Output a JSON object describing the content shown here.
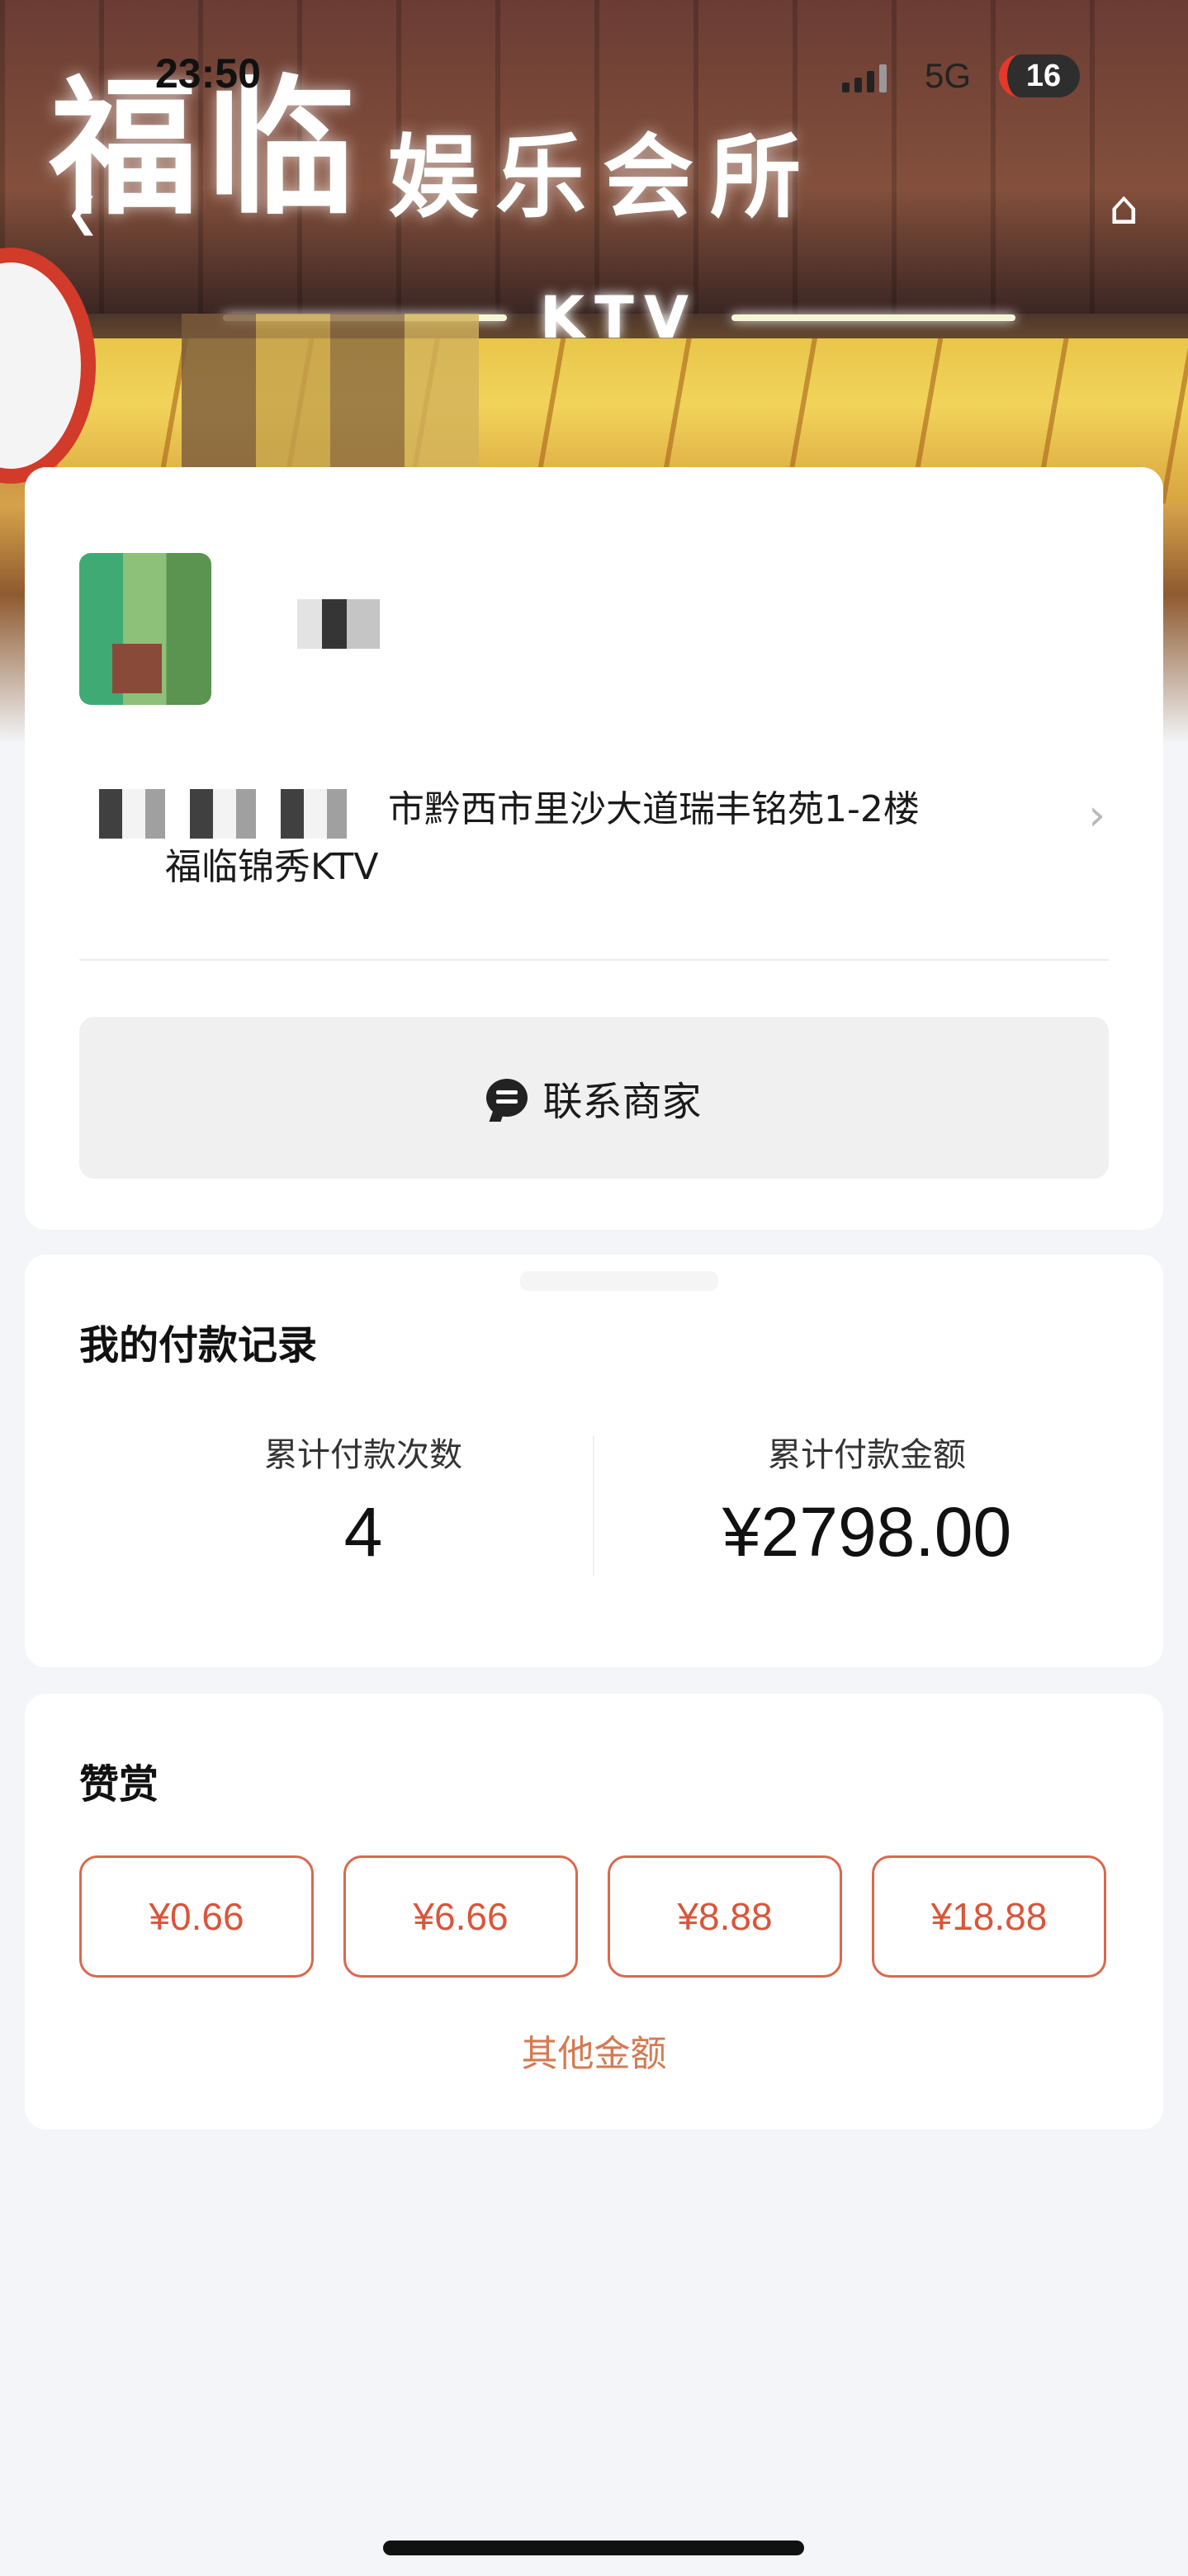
{
  "status_bar": {
    "time": "23:50",
    "network": "5G",
    "battery": "16"
  },
  "hero": {
    "sign_big": "福临",
    "sign_small": "娱乐会所",
    "sign_ktv": "KTV",
    "icons": [
      "back-arrow-icon",
      "home-icon"
    ]
  },
  "merchant": {
    "address_line1": "市黔西市里沙大道瑞丰铭苑1-2楼",
    "address_line2": "福临锦秀KTV",
    "contact_label": "联系商家",
    "contact_icon": "chat-bubble-icon"
  },
  "payments": {
    "title": "我的付款记录",
    "count_label": "累计付款次数",
    "count_value": "4",
    "amount_label": "累计付款金额",
    "amount_value": "¥2798.00"
  },
  "tip": {
    "title": "赞赏",
    "options": [
      "¥0.66",
      "¥6.66",
      "¥8.88",
      "¥18.88"
    ],
    "other_label": "其他金额",
    "accent_color": "#d9553a"
  }
}
